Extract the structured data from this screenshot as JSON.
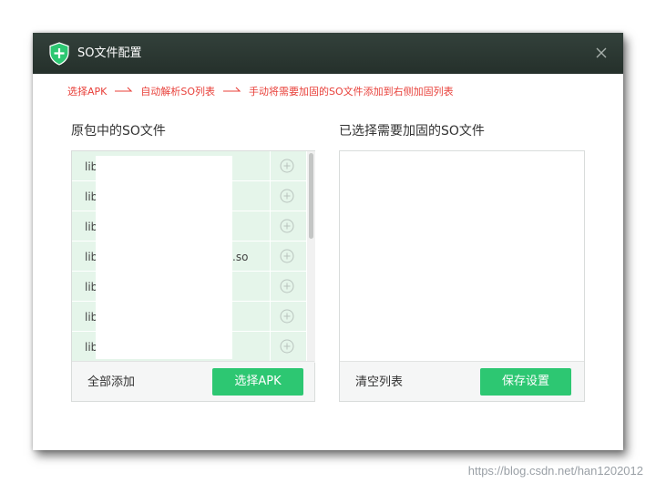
{
  "dialog": {
    "title": "SO文件配置",
    "shield_color": "#2dc772"
  },
  "steps": {
    "step1": "选择APK",
    "step2": "自动解析SO列表",
    "step3": "手动将需要加固的SO文件添加到右侧加固列表",
    "arrow_glyph": "→",
    "color": "#e8403a"
  },
  "left_panel": {
    "title": "原包中的SO文件",
    "rows": [
      {
        "name": "lib"
      },
      {
        "name": "lib"
      },
      {
        "name": "lib"
      },
      {
        "name": "lib",
        "suffix": ".so"
      },
      {
        "name": "lib"
      },
      {
        "name": "lib"
      },
      {
        "name": "lib"
      }
    ],
    "add_all_label": "全部添加",
    "select_apk_label": "选择APK"
  },
  "right_panel": {
    "title": "已选择需要加固的SO文件",
    "clear_label": "清空列表",
    "save_label": "保存设置"
  },
  "watermark": "https://blog.csdn.net/han1202012",
  "colors": {
    "titlebar": "#2b3732",
    "row_bg": "#e5f5ea",
    "button_green": "#2dc772"
  }
}
